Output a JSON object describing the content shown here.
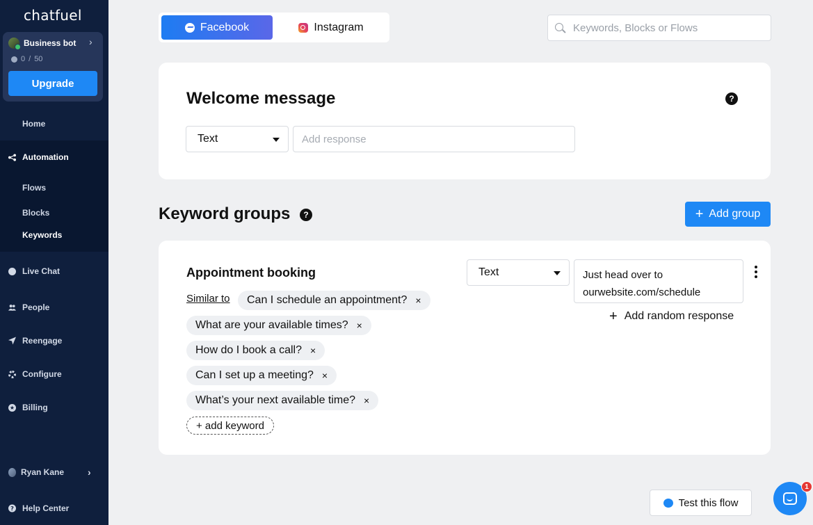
{
  "sidebar": {
    "logo": "chatfuel",
    "bot": {
      "name": "Business bot",
      "usage_used": "0",
      "usage_sep": " / ",
      "usage_total": "50",
      "upgrade_label": "Upgrade"
    },
    "nav": {
      "home": "Home",
      "automation": "Automation",
      "flows": "Flows",
      "blocks": "Blocks",
      "keywords": "Keywords",
      "live_chat": "Live Chat",
      "people": "People",
      "reengage": "Reengage",
      "configure": "Configure",
      "billing": "Billing"
    },
    "user_name": "Ryan Kane",
    "help_center": "Help Center"
  },
  "platform_tabs": {
    "facebook": "Facebook",
    "instagram": "Instagram",
    "active": "Facebook"
  },
  "search": {
    "placeholder": "Keywords, Blocks or Flows",
    "value": ""
  },
  "welcome": {
    "title": "Welcome message",
    "type_select": "Text",
    "response_placeholder": "Add response",
    "help": "?"
  },
  "keyword_groups": {
    "title": "Keyword groups",
    "help": "?",
    "add_group_label": "Add group",
    "groups": [
      {
        "name": "Appointment booking",
        "similar_to_label": "Similar to",
        "keywords": [
          "Can I schedule an appointment?",
          "What are your available times?",
          "How do I book a call?",
          "Can I set up a meeting?",
          "What’s your next available time?"
        ],
        "add_keyword_label": "+ add keyword",
        "response_type": "Text",
        "response_text": "Just head over to ourwebsite.com/schedule",
        "add_random_label": "Add random response"
      }
    ]
  },
  "footer": {
    "test_flow_label": "Test this flow",
    "chat_badge": "1"
  },
  "colors": {
    "sidebar_bg": "#0f1f3d",
    "accent": "#1e88f5",
    "page_bg": "#eff0f2"
  }
}
